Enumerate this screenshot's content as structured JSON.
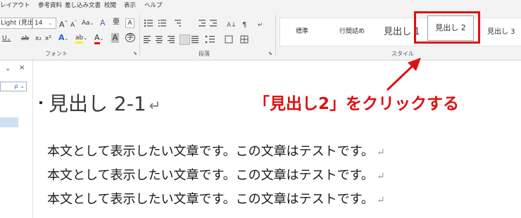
{
  "menu": {
    "items": [
      "レイアウト",
      "参考資料",
      "差し込み文書",
      "校閲",
      "表示",
      "ヘルプ"
    ]
  },
  "font_group": {
    "font_name": "Light (見出",
    "font_size": "14",
    "grow": "A",
    "shrink": "A",
    "change_case": "Aa",
    "clear_format": "A",
    "phonetic": "亜",
    "char_border": "A",
    "underline": "U",
    "strikethrough": "ab",
    "subscript": "x₂",
    "superscript": "x²",
    "text_effects": "A",
    "highlight": "ab",
    "font_color": "A",
    "char_shading": "A",
    "enclose": "字",
    "label": "フォント"
  },
  "paragraph_group": {
    "label": "段落"
  },
  "styles_group": {
    "items": [
      "標準",
      "行間詰め",
      "見出し 1",
      "見出し 2",
      "見出し 3"
    ],
    "label": "スタイル"
  },
  "nav_pane": {
    "close": "×",
    "dropdown": "⌄",
    "search_icon_text": "ρ ⌄"
  },
  "document": {
    "heading": "見出し 2-1",
    "paragraphs": [
      "本文として表示したい文章です。この文章はテストです。",
      "本文として表示したい文章です。この文章はテストです。",
      "本文として表示したい文章です。この文章はテストです。"
    ],
    "return_mark": "↵"
  },
  "annotation": {
    "text": "「見出し2」をクリックする",
    "color": "#e01010"
  }
}
